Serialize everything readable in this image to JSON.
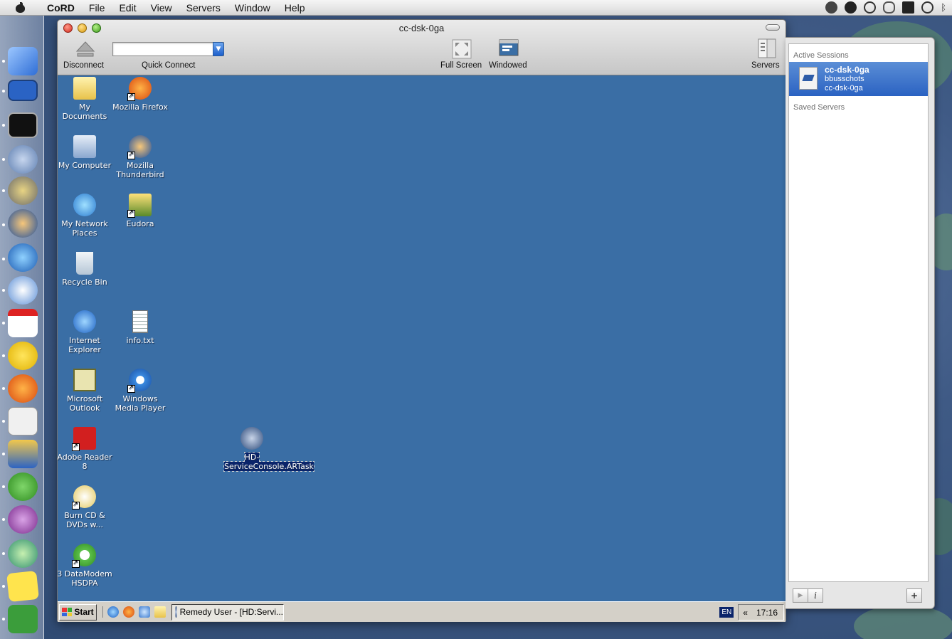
{
  "menubar": {
    "app_name": "CoRD",
    "items": [
      "File",
      "Edit",
      "View",
      "Servers",
      "Window",
      "Help"
    ],
    "status_icons": [
      "webcam-icon",
      "checkmark-icon",
      "time-machine-icon",
      "chat-icon",
      "spaces-icon",
      "sync-icon",
      "bluetooth-icon"
    ]
  },
  "window": {
    "title": "cc-dsk-0ga",
    "toolbar": {
      "disconnect": "Disconnect",
      "quick_connect": "Quick Connect",
      "quick_connect_value": "",
      "full_screen": "Full Screen",
      "windowed": "Windowed",
      "servers": "Servers"
    }
  },
  "desktop": {
    "icons": [
      {
        "label": "My Documents",
        "icon": "my-documents-icon"
      },
      {
        "label": "Mozilla Firefox",
        "icon": "firefox-icon"
      },
      {
        "label": "My Computer",
        "icon": "my-computer-icon"
      },
      {
        "label": "Mozilla Thunderbird",
        "icon": "thunderbird-icon"
      },
      {
        "label": "My Network Places",
        "icon": "network-places-icon"
      },
      {
        "label": "Eudora",
        "icon": "eudora-icon"
      },
      {
        "label": "Recycle Bin",
        "icon": "recycle-bin-icon"
      },
      {
        "label": "Internet Explorer",
        "icon": "internet-explorer-icon"
      },
      {
        "label": "info.txt",
        "icon": "text-file-icon"
      },
      {
        "label": "Microsoft Outlook",
        "icon": "outlook-icon"
      },
      {
        "label": "Windows Media Player",
        "icon": "media-player-icon"
      },
      {
        "label": "Adobe Reader 8",
        "icon": "adobe-reader-icon"
      },
      {
        "label": "HD-ServiceConsole.ARTask",
        "icon": "artask-icon"
      },
      {
        "label": "Burn CD & DVDs w...",
        "icon": "burn-cd-icon"
      },
      {
        "label": "3 DataModem HSDPA",
        "icon": "datamodem-icon"
      }
    ]
  },
  "taskbar": {
    "start": "Start",
    "task": "Remedy User - [HD:Servi...",
    "language": "EN",
    "chevron": "«",
    "time": "17:16"
  },
  "drawer": {
    "active_sessions": "Active Sessions",
    "session": {
      "name": "cc-dsk-0ga",
      "user": "bbusschots",
      "host": "cc-dsk-0ga"
    },
    "saved_servers": "Saved Servers",
    "play": "▶",
    "info": "i",
    "add": "+"
  }
}
